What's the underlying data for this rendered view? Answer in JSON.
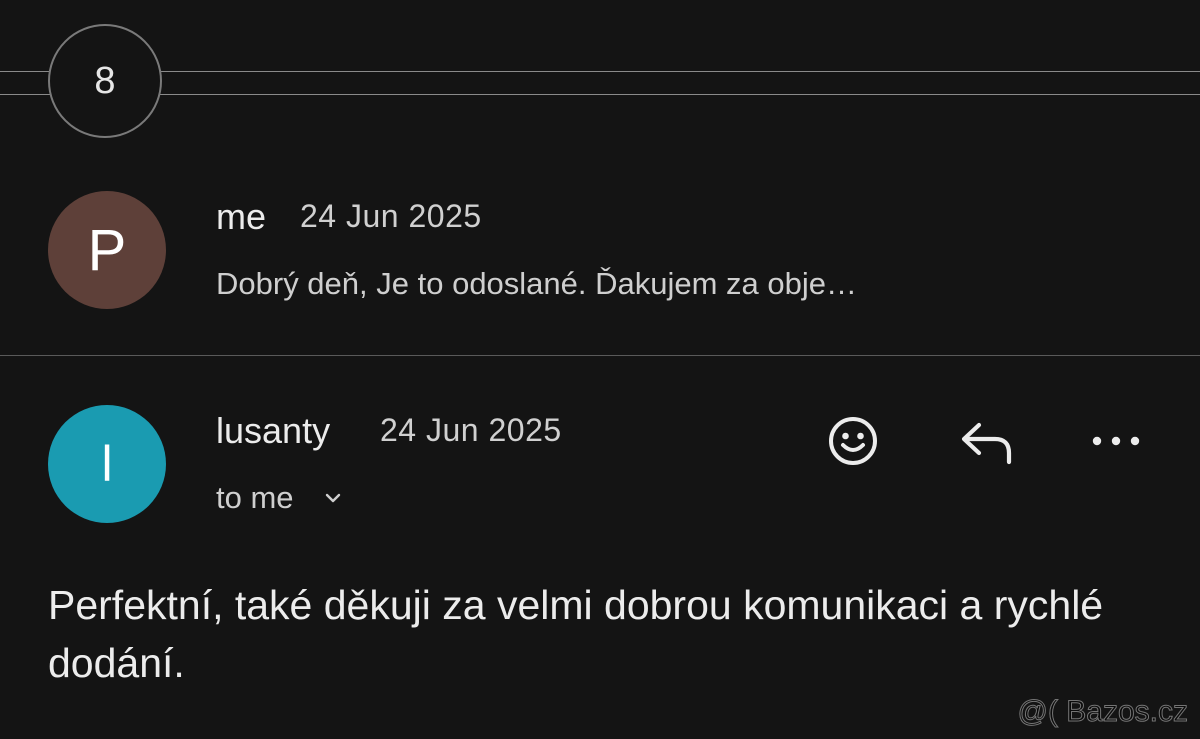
{
  "thread": {
    "collapsed_count": "8"
  },
  "messages": [
    {
      "avatar_letter": "P",
      "avatar_color": "#5e4039",
      "sender": "me",
      "date": "24 Jun 2025",
      "snippet": "Dobrý deň, Je to odoslané. Ďakujem za obje…"
    },
    {
      "avatar_letter": "l",
      "avatar_color": "#1a9bb1",
      "sender": "lusanty",
      "date": "24 Jun 2025",
      "recipients": "to me",
      "body": "Perfektní, také děkuji za velmi dobrou komunikaci a rychlé dodání."
    }
  ],
  "actions": {
    "emoji_icon": "smiley-icon",
    "reply_icon": "reply-icon",
    "more_icon": "more-horizontal-icon",
    "expand_icon": "chevron-down-icon"
  },
  "watermark": "@( Bazos.cz"
}
